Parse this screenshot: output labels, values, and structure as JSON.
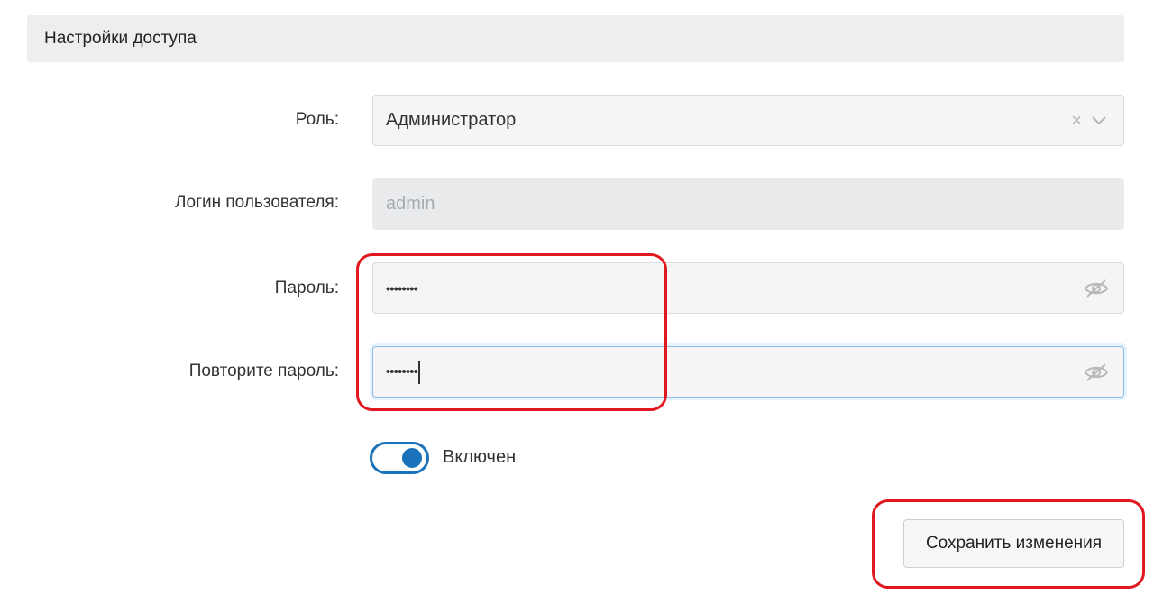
{
  "section": {
    "title": "Настройки доступа"
  },
  "form": {
    "role": {
      "label": "Роль:",
      "value": "Администратор",
      "clear_icon": "×"
    },
    "login": {
      "label": "Логин пользователя:",
      "placeholder": "admin"
    },
    "password": {
      "label": "Пароль:",
      "masked": "••••••••"
    },
    "password_repeat": {
      "label": "Повторите пароль:",
      "masked": "••••••••"
    },
    "enabled": {
      "label": "Включен",
      "on": true
    },
    "save_label": "Сохранить изменения"
  },
  "colors": {
    "accent": "#1a73ba",
    "highlight": "#e0191f",
    "header_bg": "#eeeeee"
  },
  "icons": [
    "close-icon",
    "chevron-down-icon",
    "eye-slash-icon"
  ]
}
